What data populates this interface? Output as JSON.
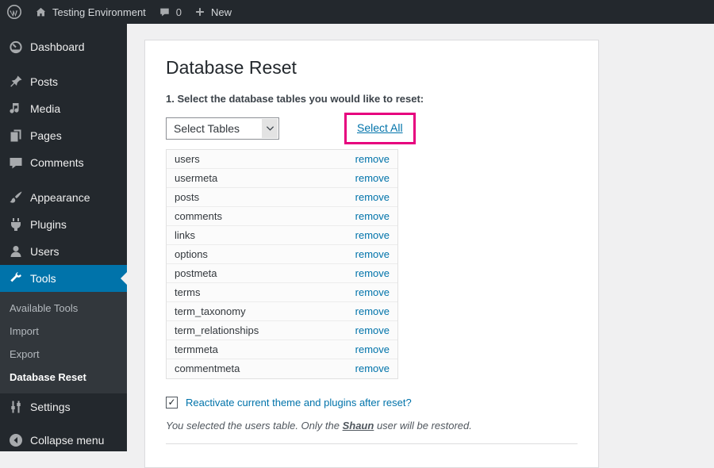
{
  "admin_bar": {
    "site_name": "Testing Environment",
    "comments_count": "0",
    "new_label": "New"
  },
  "sidebar": {
    "items": [
      {
        "label": "Dashboard"
      },
      {
        "label": "Posts"
      },
      {
        "label": "Media"
      },
      {
        "label": "Pages"
      },
      {
        "label": "Comments"
      },
      {
        "label": "Appearance"
      },
      {
        "label": "Plugins"
      },
      {
        "label": "Users"
      },
      {
        "label": "Tools"
      },
      {
        "label": "Settings"
      },
      {
        "label": "Collapse menu"
      }
    ],
    "tools_submenu": [
      {
        "label": "Available Tools"
      },
      {
        "label": "Import"
      },
      {
        "label": "Export"
      },
      {
        "label": "Database Reset"
      }
    ]
  },
  "main": {
    "title": "Database Reset",
    "step1_label": "1. Select the database tables you would like to reset:",
    "table_select_value": "Select Tables",
    "select_all_label": "Select All",
    "tables": [
      "users",
      "usermeta",
      "posts",
      "comments",
      "links",
      "options",
      "postmeta",
      "terms",
      "term_taxonomy",
      "term_relationships",
      "termmeta",
      "commentmeta"
    ],
    "remove_label": "remove",
    "checkbox_checked": "✓",
    "reactivate_label": "Reactivate current theme and plugins after reset?",
    "note": {
      "prefix": "You selected the users table. Only the ",
      "username": "Shaun",
      "suffix": " user will be restored."
    }
  },
  "colors": {
    "accent_blue": "#0073aa",
    "highlight_pink": "#e6007e",
    "admin_dark": "#23282d"
  }
}
